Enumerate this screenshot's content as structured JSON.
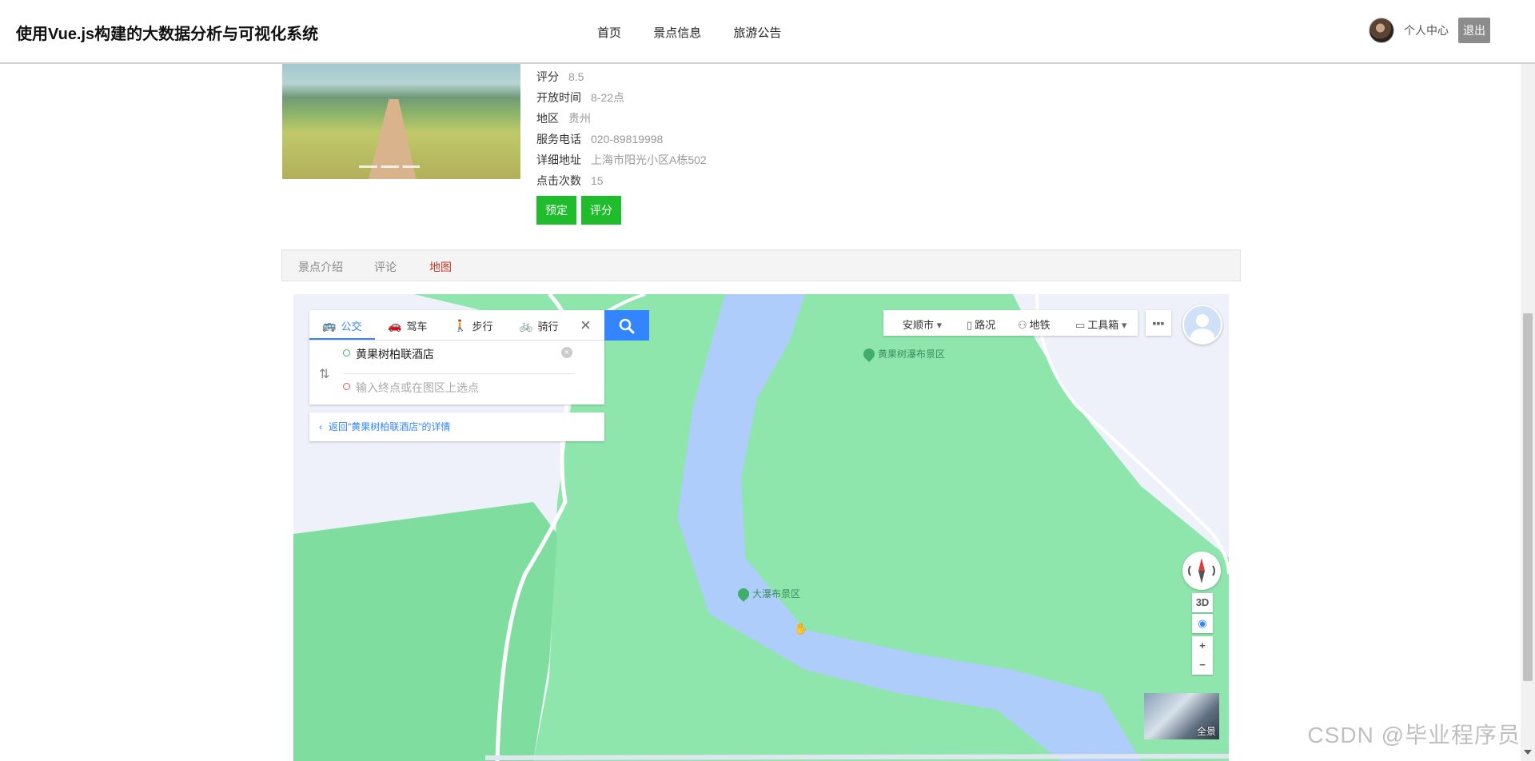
{
  "header": {
    "site_title": "使用Vue.js构建的大数据分析与可视化系统",
    "nav": [
      "首页",
      "景点信息",
      "旅游公告"
    ],
    "user_center": "个人中心",
    "logout": "退出"
  },
  "spot": {
    "info": [
      {
        "label": "评分",
        "value": "8.5"
      },
      {
        "label": "开放时间",
        "value": "8-22点"
      },
      {
        "label": "地区",
        "value": "贵州"
      },
      {
        "label": "服务电话",
        "value": "020-89819998"
      },
      {
        "label": "详细地址",
        "value": "上海市阳光小区A栋502"
      },
      {
        "label": "点击次数",
        "value": "15"
      }
    ],
    "buttons": {
      "book": "预定",
      "rate": "评分"
    }
  },
  "tabs": [
    {
      "label": "景点介绍",
      "active": false
    },
    {
      "label": "评论",
      "active": false
    },
    {
      "label": "地图",
      "active": true
    }
  ],
  "map": {
    "modes": [
      {
        "label": "公交",
        "icon": "bus-icon",
        "active": true
      },
      {
        "label": "驾车",
        "icon": "car-icon",
        "active": false
      },
      {
        "label": "步行",
        "icon": "walk-icon",
        "active": false
      },
      {
        "label": "骑行",
        "icon": "bike-icon",
        "active": false
      }
    ],
    "start_point": "黄果树柏联酒店",
    "end_placeholder": "输入终点或在图区上选点",
    "back_link": "返回\"黄果树柏联酒店\"的详情",
    "toolbar": {
      "city": "安顺市",
      "traffic": "路况",
      "subway": "地铁",
      "toolbox": "工具箱"
    },
    "pois": [
      "黄果树瀑布景区",
      "大瀑布景区"
    ],
    "controls": {
      "three_d": "3D",
      "zoom_in": "+",
      "zoom_out": "−"
    },
    "panorama": "全景"
  },
  "watermark": "CSDN @毕业程序员",
  "colors": {
    "accent_green": "#1fbd2c",
    "map_blue": "#3385ff",
    "active_tab": "#c0392b"
  }
}
